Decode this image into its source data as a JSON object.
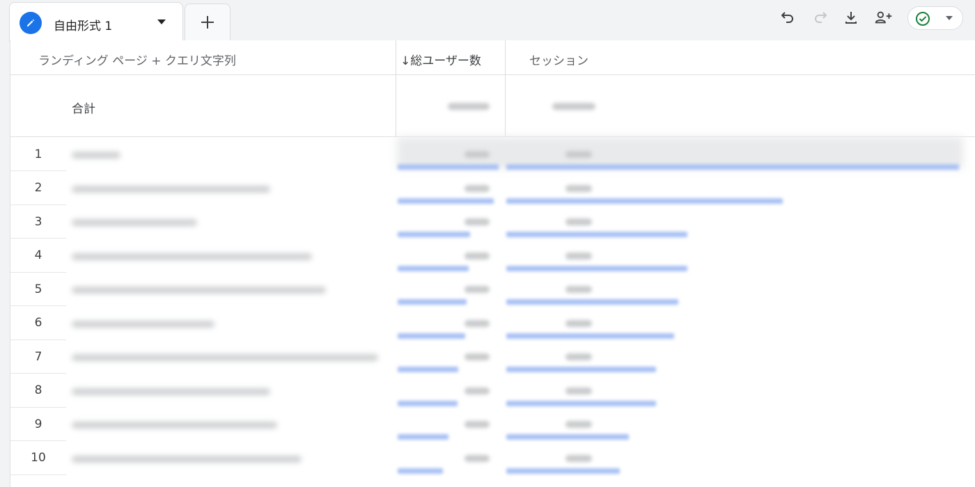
{
  "tab": {
    "title": "自由形式 1",
    "icon": "pencil-icon"
  },
  "toolbar": {
    "add_tab_icon": "plus-icon",
    "undo_icon": "undo-icon",
    "redo_icon": "redo-icon",
    "download_icon": "download-icon",
    "share_icon": "share-user-icon",
    "status_icon": "check-circle-icon"
  },
  "colors": {
    "accent": "#1a73e8",
    "bar": "#a8c1f5",
    "check": "#188038"
  },
  "table": {
    "columns": {
      "dimension": "ランディング ページ + クエリ文字列",
      "users": "↓総ユーザー数",
      "sessions": "セッション"
    },
    "total_label": "合計",
    "rows": [
      {
        "rank": "1",
        "users_bar": 1.0,
        "sessions_bar": 1.0
      },
      {
        "rank": "2",
        "users_bar": 0.95,
        "sessions_bar": 0.61
      },
      {
        "rank": "3",
        "users_bar": 0.72,
        "sessions_bar": 0.4
      },
      {
        "rank": "4",
        "users_bar": 0.7,
        "sessions_bar": 0.4
      },
      {
        "rank": "5",
        "users_bar": 0.68,
        "sessions_bar": 0.38
      },
      {
        "rank": "6",
        "users_bar": 0.67,
        "sessions_bar": 0.37
      },
      {
        "rank": "7",
        "users_bar": 0.6,
        "sessions_bar": 0.33
      },
      {
        "rank": "8",
        "users_bar": 0.59,
        "sessions_bar": 0.33
      },
      {
        "rank": "9",
        "users_bar": 0.5,
        "sessions_bar": 0.27
      },
      {
        "rank": "10",
        "users_bar": 0.45,
        "sessions_bar": 0.25
      }
    ]
  }
}
